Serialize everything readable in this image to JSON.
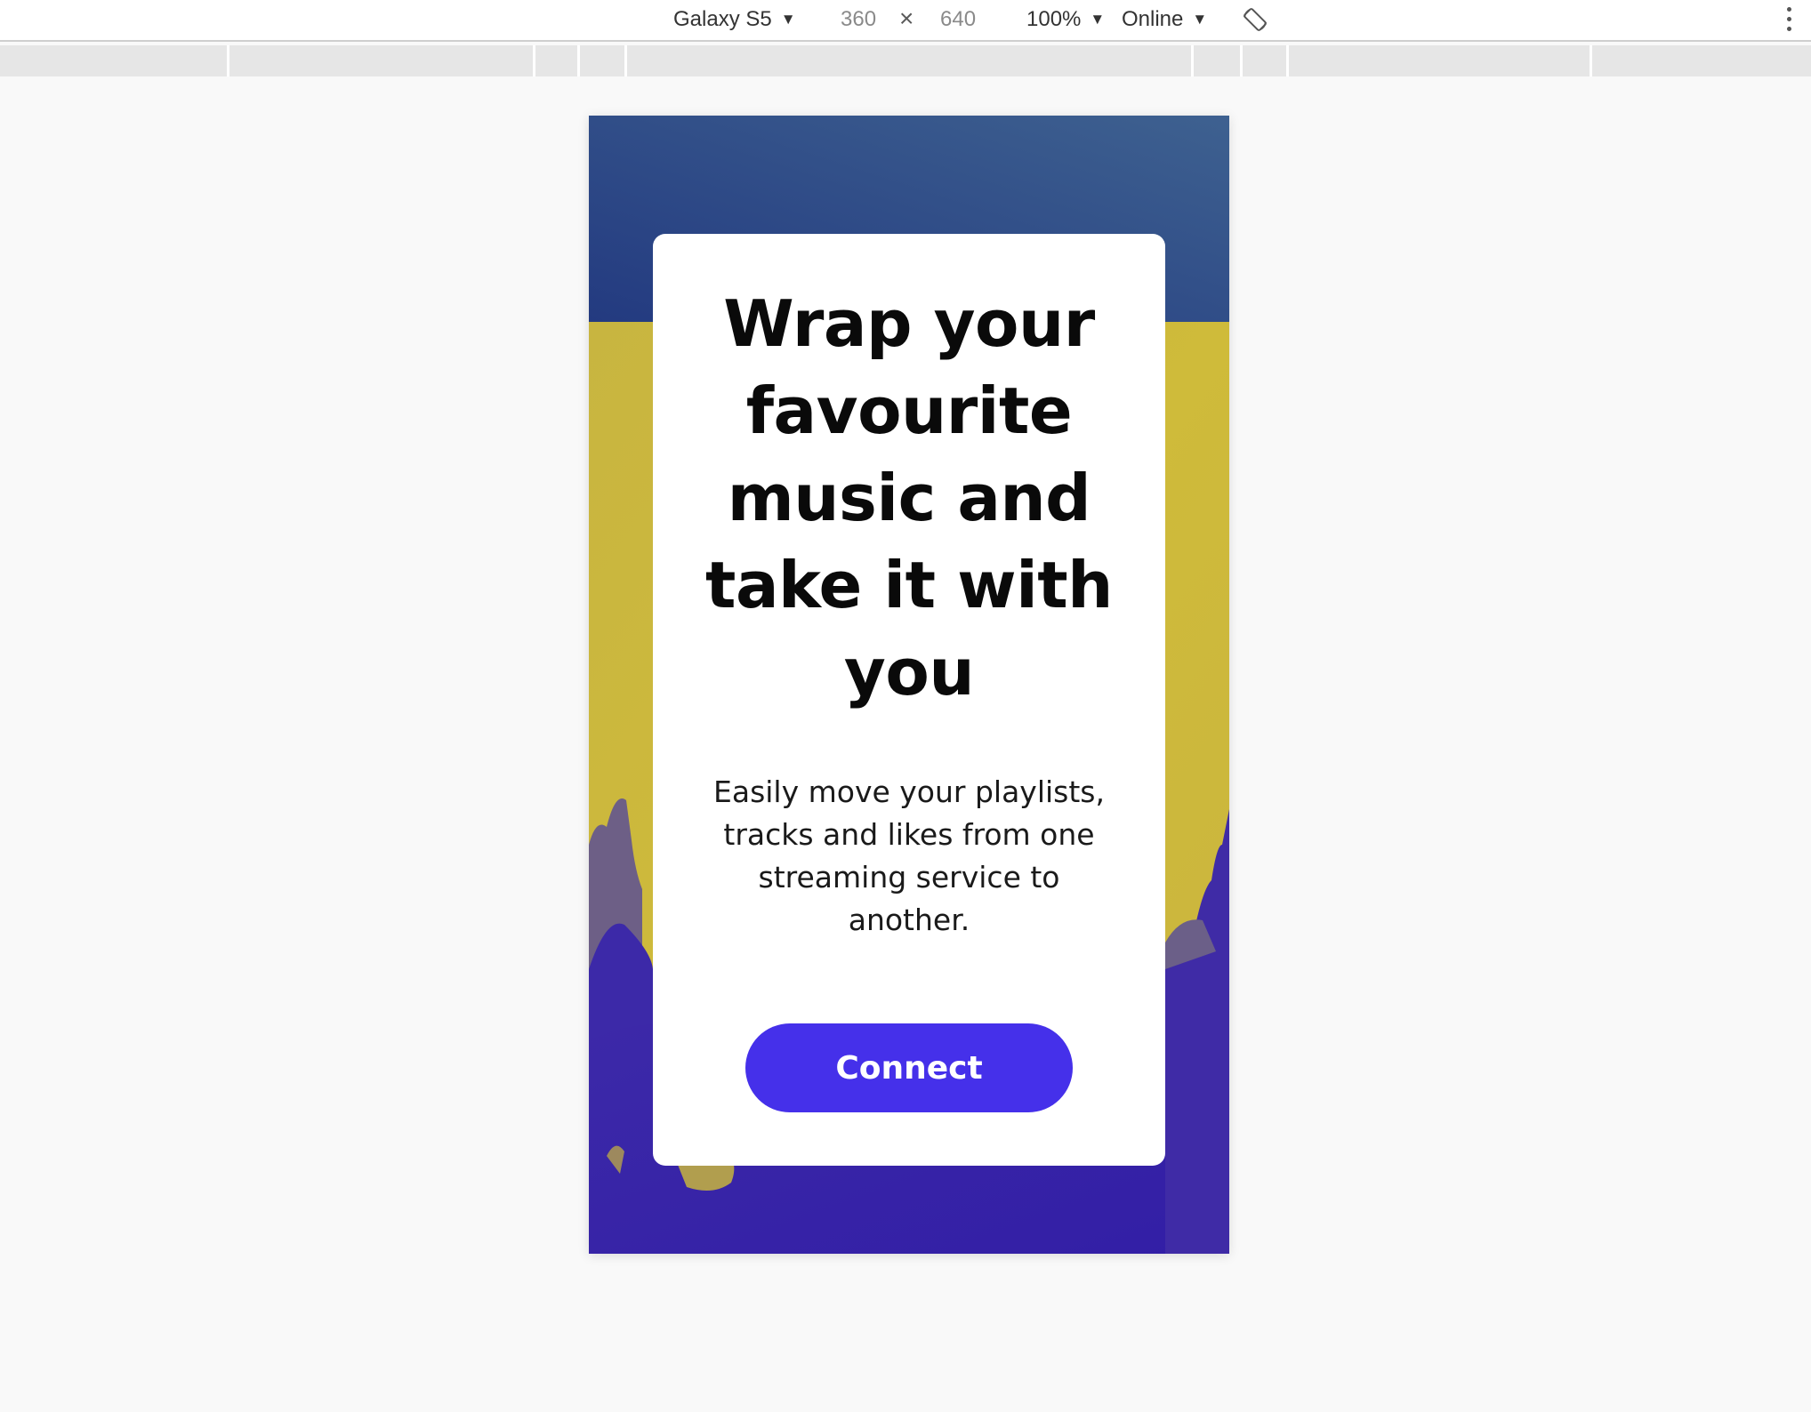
{
  "devtools": {
    "device": "Galaxy S5",
    "width": "360",
    "times": "×",
    "height": "640",
    "zoom": "100%",
    "network": "Online",
    "icons": [
      "caret-down-icon",
      "rotate-icon",
      "more-vert-icon"
    ]
  },
  "page": {
    "headline": "Wrap your favourite music and take it with you",
    "subtext": "Easily move your playlists, tracks and likes from one streaming service to another.",
    "button_label": "Connect"
  },
  "colors": {
    "top_band": "#2f4a8c",
    "middle_band": "#c9b63c",
    "bottom_band": "#3a23a4",
    "button": "#4530ea",
    "card": "#ffffff",
    "page_bg": "#f9f9f9"
  }
}
